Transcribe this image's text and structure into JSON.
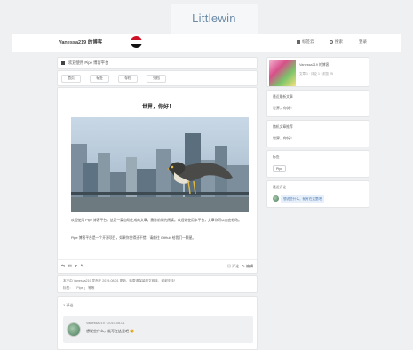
{
  "brand": {
    "title": "Littlewin"
  },
  "topbar": {
    "site_name": "Vanessa219 的博客",
    "nav": [
      {
        "icon": "archive-icon",
        "label": "标签云"
      },
      {
        "icon": "search-icon",
        "label": "搜索"
      },
      {
        "icon": "",
        "label": "登录"
      }
    ]
  },
  "breadcrumb": {
    "text": "欢迎使用 Pipe 博客平台"
  },
  "tabs": [
    "首页",
    "标签",
    "存档",
    "归档"
  ],
  "article": {
    "title": "世界，你好！",
    "paragraphs": [
      "欢迎使用 Pipe 博客平台，这是一篇自动生成的文章，删除前请先阅读。欢迎你使用本平台，文章你可以自由修改。",
      "Pipe 博客平台是一个开源项目，如果你觉得还不错，请前往 GitHub 给我们一颗星。"
    ],
    "share_icons": "⇆ ✉ ♥ ✎",
    "action_comment": "评论",
    "action_edit": "编辑"
  },
  "meta": {
    "line1": "本文由 Vanessa219 发布于 2019-08-01 更新，转载请保留原文链接，谢谢支持！",
    "line2": "标签：「 Pipe 」 等等"
  },
  "comments": {
    "title": "1 评论",
    "items": [
      {
        "name": "Vanessa219 · 2019-08-01",
        "text": "想说些什么，就写在这里吧 😊"
      }
    ]
  },
  "sidebar": {
    "profile": {
      "name": "Vanessa219 的博客",
      "stats": "文章 1 · 评论 1 · 浏览 25"
    },
    "cards": [
      {
        "head": "最近最新文章",
        "link": "世界，你好！"
      },
      {
        "head": "随机文章推荐",
        "link": "世界，你好！"
      },
      {
        "head": "标签",
        "chip": "Pipe"
      },
      {
        "head": "最近评论",
        "quote": "想说些什么，就写在这里吧"
      }
    ]
  },
  "colors": {
    "page_bg": "#eef0f2",
    "brand_text": "#6a8aa8",
    "quote_bg": "#e7f0fa",
    "link_blue": "#4a78b0"
  }
}
